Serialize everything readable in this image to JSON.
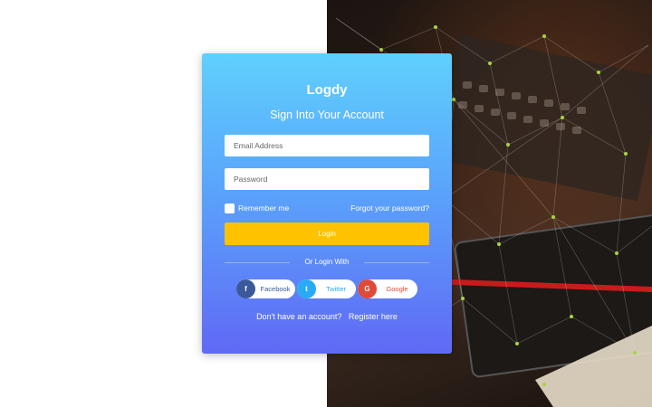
{
  "brand": {
    "name": "Logdy"
  },
  "form": {
    "title": "Sign Into Your Account",
    "email_placeholder": "Email Address",
    "password_placeholder": "Password",
    "remember_label": "Remember me",
    "forgot_label": "Forgot your password?",
    "login_label": "Login",
    "divider_text": "Or Login With"
  },
  "social": {
    "facebook": {
      "icon": "f",
      "label": "Facebook"
    },
    "twitter": {
      "icon": "t",
      "label": "Twitter"
    },
    "google": {
      "icon": "G",
      "label": "Google"
    }
  },
  "footer": {
    "prompt": "Don't have an account?",
    "register_label": "Register here"
  },
  "colors": {
    "card_top": "#5fd0fd",
    "card_bottom": "#6069f5",
    "login_button": "#fec200",
    "facebook": "#3b5998",
    "twitter": "#29aaf4",
    "google": "#dd4b39"
  }
}
